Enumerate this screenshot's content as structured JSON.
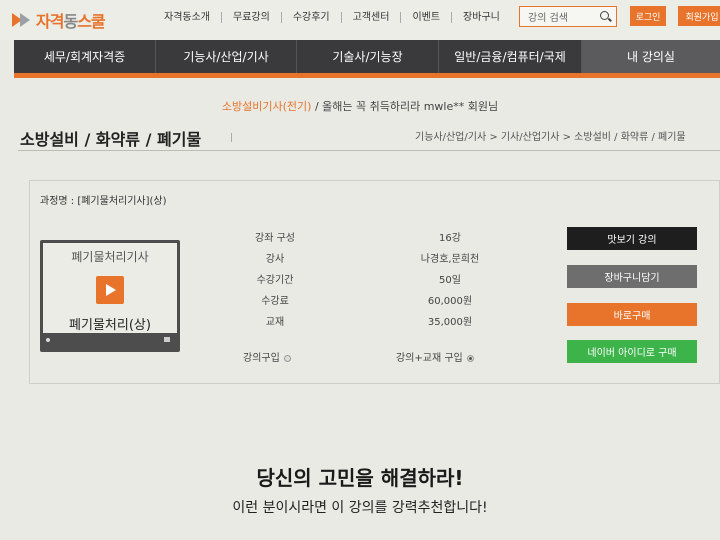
{
  "logo": {
    "part1": "자격",
    "part2": "동",
    "part3": "스쿨"
  },
  "topnav": [
    "자격동소개",
    "무료강의",
    "수강후기",
    "고객센터",
    "이벤트",
    "장바구니"
  ],
  "search": {
    "placeholder": "강의 검색"
  },
  "auth": {
    "login": "로그인",
    "join": "회원가입"
  },
  "mainnav": [
    "세무/회계자격증",
    "기능사/산업/기사",
    "기술사/기능장",
    "일반/금융/컴퓨터/국제",
    "내 강의실"
  ],
  "greeting": {
    "highlight": "소방설비기사(전기)",
    "rest": "/ 올해는 꼭 취득하리라 mwle** 회원님"
  },
  "page": {
    "title": "소방설비 / 화약류 / 폐기물",
    "breadcrumb": "기능사/산업/기사 > 기사/산업기사 > 소방설비 / 화약류 / 폐기물"
  },
  "course": {
    "name": "과정명 : [폐기물처리기사](상)",
    "thumb_top": "폐기물처리기사",
    "thumb_bottom": "폐기물처리(상)",
    "rows": [
      {
        "label": "강좌 구성",
        "value": "16강"
      },
      {
        "label": "강사",
        "value": "나경호,문희천"
      },
      {
        "label": "수강기간",
        "value": "50일"
      },
      {
        "label": "수강료",
        "value": "60,000원"
      },
      {
        "label": "교재",
        "value": "35,000원"
      }
    ],
    "option_lecture": "강의구입",
    "option_bundle": "강의+교재 구입"
  },
  "actions": {
    "preview": "맛보기 강의",
    "cart": "장바구니담기",
    "buy": "바로구매",
    "naver": "네이버 아이디로 구매"
  },
  "colors": {
    "accent": "#e8742c",
    "nav": "#3a3a3c",
    "dark_button": "#1e1e1e",
    "gray_button": "#6e6e6e",
    "green_button": "#3cb44a"
  },
  "promo": {
    "headline": "당신의 고민을 해결하라!",
    "subline": "이런 분이시라면 이 강의를 강력추천합니다!"
  }
}
